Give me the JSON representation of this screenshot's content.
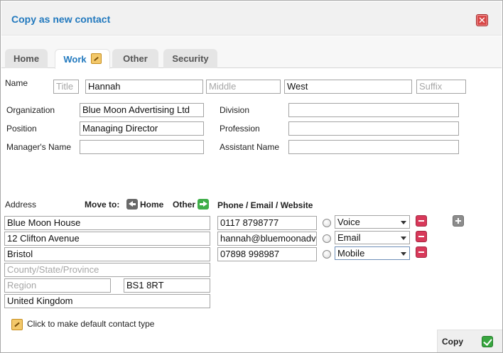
{
  "dialog": {
    "title": "Copy as new contact"
  },
  "tabs": [
    {
      "label": "Home"
    },
    {
      "label": "Work"
    },
    {
      "label": "Other"
    },
    {
      "label": "Security"
    }
  ],
  "name": {
    "label": "Name",
    "title_placeholder": "Title",
    "first": "Hannah",
    "middle_placeholder": "Middle",
    "last": "West",
    "suffix_placeholder": "Suffix"
  },
  "work": {
    "organization_label": "Organization",
    "organization": "Blue Moon Advertising Ltd",
    "position_label": "Position",
    "position": "Managing Director",
    "manager_label": "Manager's Name",
    "manager": "",
    "division_label": "Division",
    "division": "",
    "profession_label": "Profession",
    "profession": "",
    "assistant_label": "Assistant Name",
    "assistant": ""
  },
  "address": {
    "label": "Address",
    "move_to_label": "Move to:",
    "move_home": "Home",
    "move_other": "Other",
    "line1": "Blue Moon House",
    "line2": "12 Clifton Avenue",
    "city": "Bristol",
    "county_placeholder": "County/State/Province",
    "region_placeholder": "Region",
    "postcode": "BS1 8RT",
    "country": "United Kingdom"
  },
  "contact": {
    "heading": "Phone / Email / Website",
    "rows": [
      {
        "value": "0117 8798777",
        "type": "Voice"
      },
      {
        "value": "hannah@bluemoonadv",
        "type": "Email"
      },
      {
        "value": "07898 998987",
        "type": "Mobile"
      }
    ]
  },
  "default_note": "Click to make default contact type",
  "footer": {
    "copy_label": "Copy"
  }
}
